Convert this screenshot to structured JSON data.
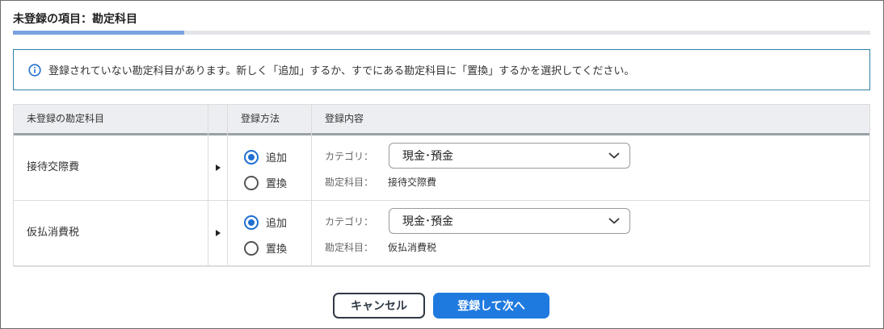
{
  "dialog": {
    "title": "未登録の項目：勘定科目",
    "progress_fraction": 0.2,
    "notice": "登録されていない勘定科目があります。新しく「追加」するか、すでにある勘定科目に「置換」するかを選択してください。"
  },
  "table": {
    "headers": {
      "name": "未登録の勘定科目",
      "method": "登録方法",
      "content": "登録内容"
    },
    "rows": [
      {
        "name": "接待交際費",
        "options": {
          "add": "追加",
          "replace": "置換"
        },
        "selected": "add",
        "category_label": "カテゴリ：",
        "category_value": "現金･預金",
        "account_label": "勘定科目：",
        "account_value": "接待交際費"
      },
      {
        "name": "仮払消費税",
        "options": {
          "add": "追加",
          "replace": "置換"
        },
        "selected": "add",
        "category_label": "カテゴリ：",
        "category_value": "現金･預金",
        "account_label": "勘定科目：",
        "account_value": "仮払消費税"
      }
    ]
  },
  "buttons": {
    "cancel": "キャンセル",
    "next": "登録して次へ"
  },
  "colors": {
    "primary": "#1f7ae0",
    "progress": "#7aa3e0",
    "notice_border": "#2f7fa6"
  }
}
